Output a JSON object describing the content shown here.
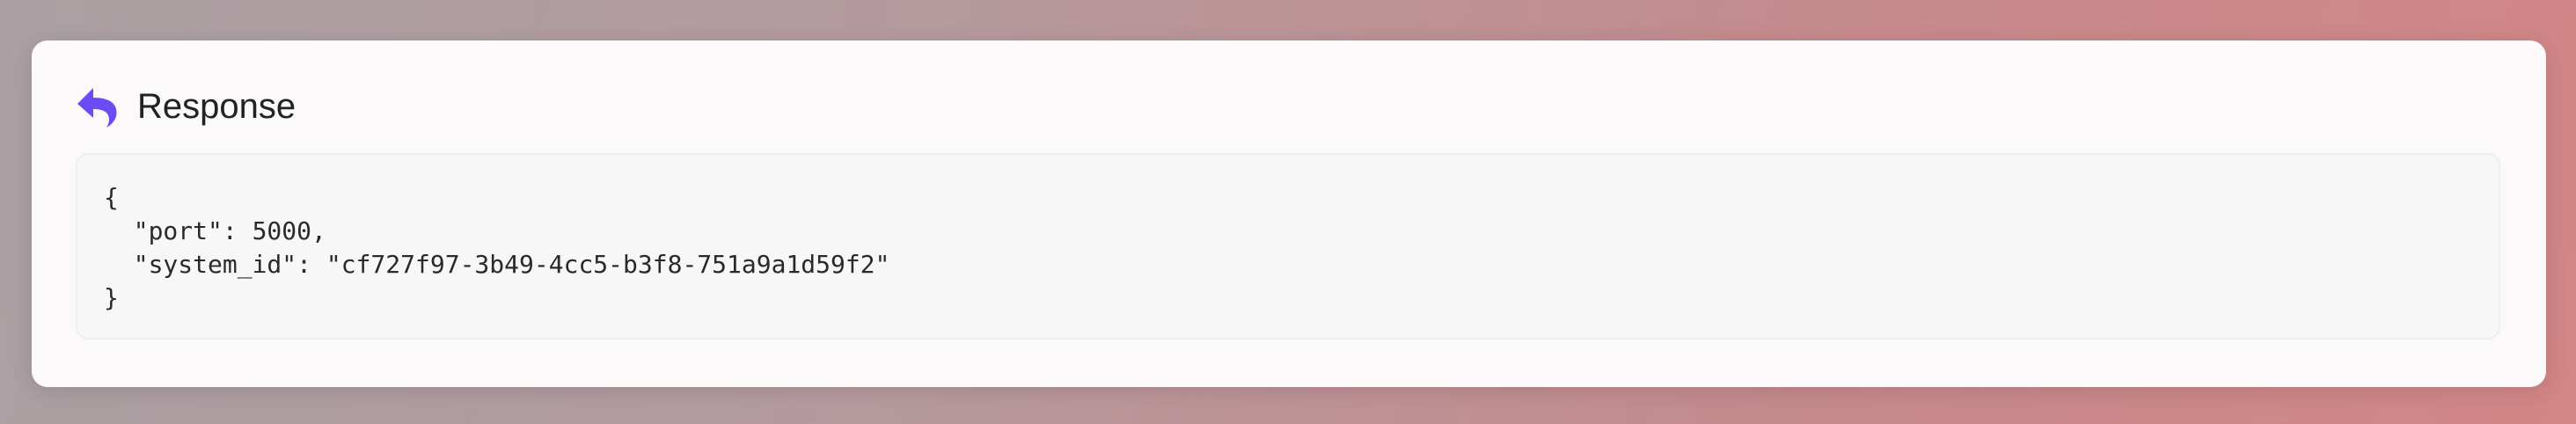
{
  "panel": {
    "title": "Response",
    "icon": "reply-arrow-icon",
    "accent_color": "#6a4cf5",
    "code_lines": [
      "{",
      "  \"port\": 5000,",
      "  \"system_id\": \"cf727f97-3b49-4cc5-b3f8-751a9a1d59f2\"",
      "}"
    ]
  }
}
